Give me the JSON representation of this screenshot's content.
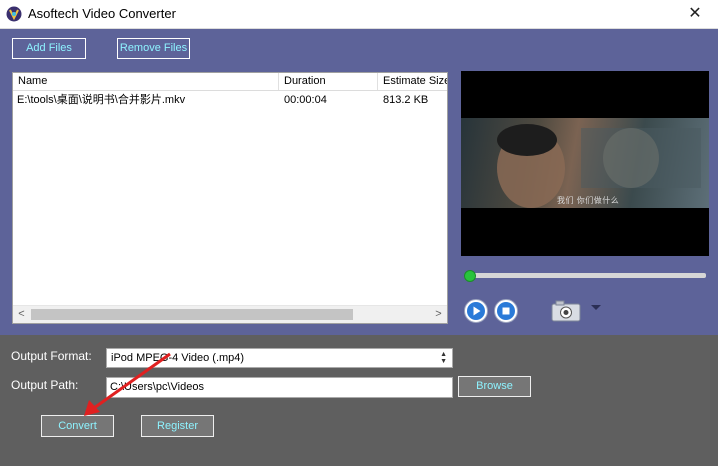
{
  "window": {
    "title": "Asoftech Video Converter",
    "close_glyph": "✕"
  },
  "toolbar": {
    "add_files_label": "Add Files",
    "remove_files_label": "Remove Files"
  },
  "file_list": {
    "columns": [
      "Name",
      "Duration",
      "Estimate Size"
    ],
    "rows": [
      {
        "name": "E:\\tools\\桌面\\说明书\\合并影片.mkv",
        "duration": "00:00:04",
        "size": "813.2 KB"
      }
    ],
    "scroll_left_glyph": "<",
    "scroll_right_glyph": ">"
  },
  "preview": {
    "subtitle_text": "我们 你们做什么"
  },
  "output": {
    "format_label": "Output Format:",
    "format_value": "iPod MPEG-4 Video (.mp4)",
    "path_label": "Output Path:",
    "path_value": "C:\\Users\\pc\\Videos",
    "browse_label": "Browse"
  },
  "actions": {
    "convert_label": "Convert",
    "register_label": "Register"
  },
  "colors": {
    "accent_text": "#8ef3ff",
    "panel_top": "#5d6399",
    "panel_bottom": "#5f5f5f",
    "annotation_arrow": "#e02020"
  }
}
